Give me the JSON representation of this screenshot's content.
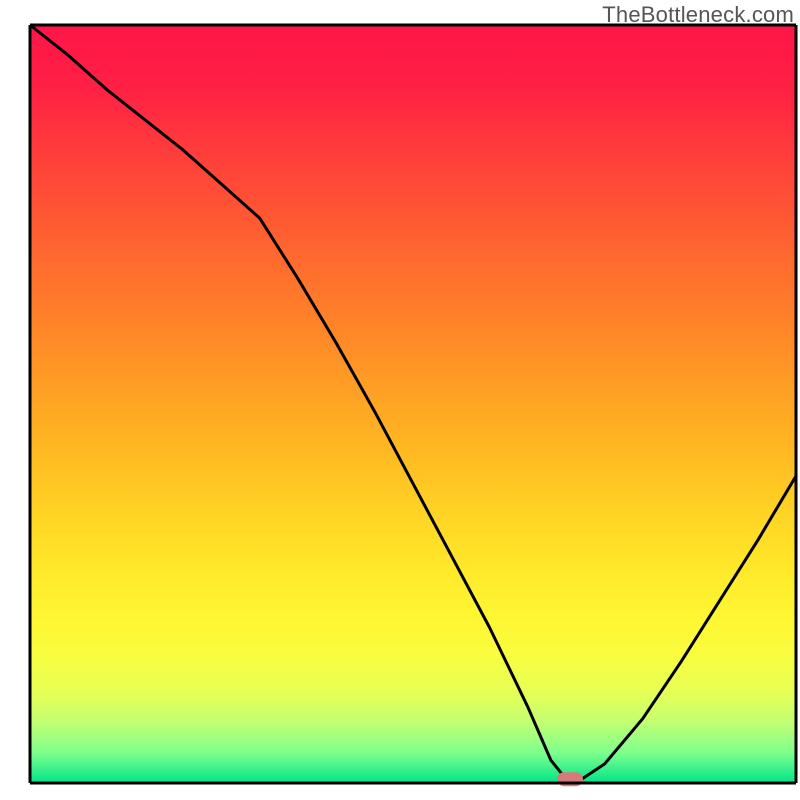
{
  "attribution": "TheBottleneck.com",
  "chart_data": {
    "type": "line",
    "title": "",
    "xlabel": "",
    "ylabel": "",
    "xlim": [
      0,
      100
    ],
    "ylim": [
      0,
      100
    ],
    "x": [
      0,
      5,
      10,
      15,
      20,
      25,
      30,
      35,
      40,
      45,
      50,
      55,
      60,
      65,
      68,
      70,
      72,
      75,
      80,
      85,
      90,
      95,
      100
    ],
    "values": [
      100,
      96,
      91.5,
      87.5,
      83.5,
      79,
      74.5,
      66.5,
      58,
      49,
      39.5,
      30,
      20.5,
      10,
      3,
      0.5,
      0.5,
      2.5,
      8.5,
      16,
      24,
      32,
      40.5
    ],
    "gradient_stops": [
      {
        "offset": 0.0,
        "color": "#ff1648"
      },
      {
        "offset": 0.08,
        "color": "#ff1f44"
      },
      {
        "offset": 0.16,
        "color": "#ff3a3c"
      },
      {
        "offset": 0.24,
        "color": "#ff5334"
      },
      {
        "offset": 0.32,
        "color": "#ff6d2e"
      },
      {
        "offset": 0.4,
        "color": "#ff8528"
      },
      {
        "offset": 0.48,
        "color": "#ff9f24"
      },
      {
        "offset": 0.56,
        "color": "#ffb822"
      },
      {
        "offset": 0.64,
        "color": "#ffd224"
      },
      {
        "offset": 0.72,
        "color": "#ffe92a"
      },
      {
        "offset": 0.78,
        "color": "#fff632"
      },
      {
        "offset": 0.83,
        "color": "#f9fd3e"
      },
      {
        "offset": 0.88,
        "color": "#e7ff55"
      },
      {
        "offset": 0.92,
        "color": "#c2ff72"
      },
      {
        "offset": 0.96,
        "color": "#7eff8d"
      },
      {
        "offset": 1.0,
        "color": "#00e589"
      }
    ],
    "marker": {
      "x": 70.5,
      "y": 0.5,
      "color": "#d77a7a"
    },
    "frame": {
      "color": "#000000",
      "width": 3
    }
  }
}
